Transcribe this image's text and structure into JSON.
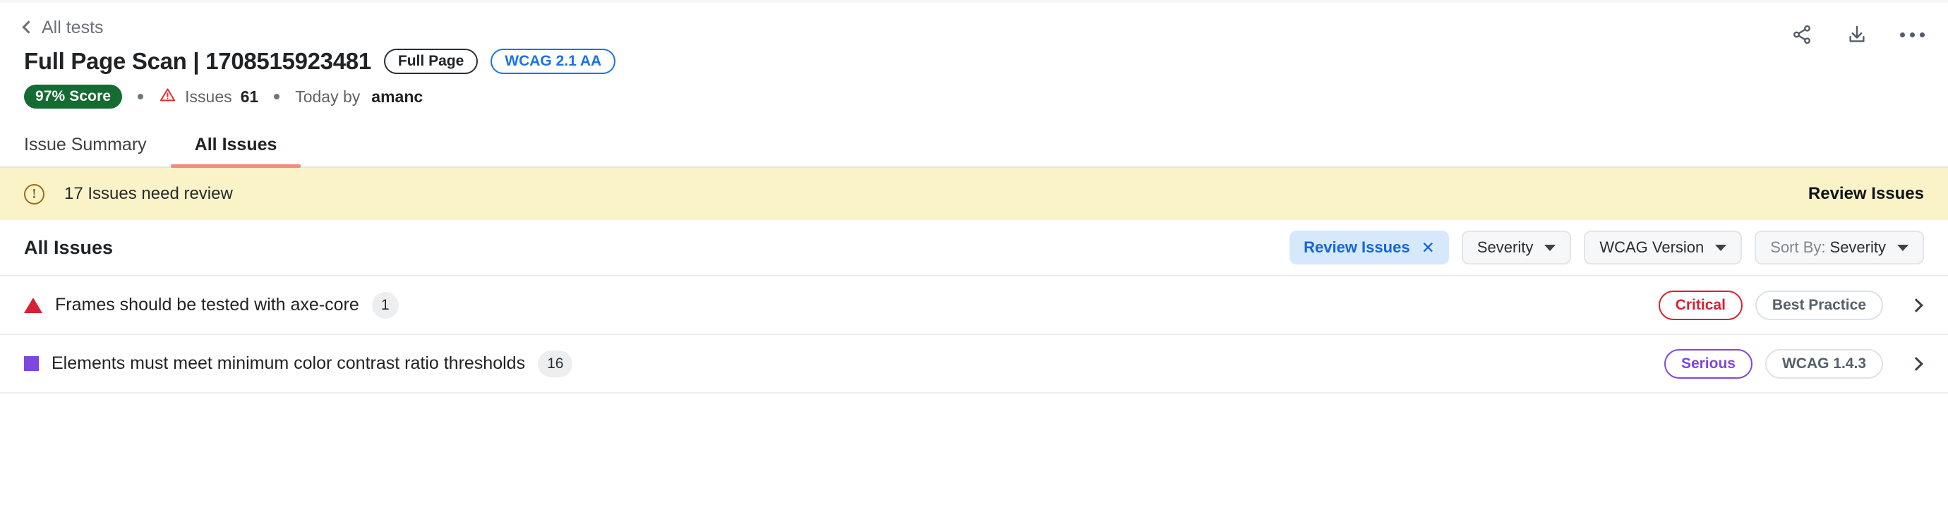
{
  "header": {
    "back_label": "All tests",
    "back_icon": "chevron-left-icon",
    "title": "Full Page Scan | 1708515923481",
    "tags": [
      {
        "label": "Full Page",
        "style": "outline-dark"
      },
      {
        "label": "WCAG 2.1 AA",
        "style": "outline-blue"
      }
    ],
    "actions": [
      {
        "name": "share-icon",
        "tooltip": "Share"
      },
      {
        "name": "download-icon",
        "tooltip": "Download"
      },
      {
        "name": "more-options-icon",
        "tooltip": "More"
      }
    ],
    "meta": {
      "score_badge": "97% Score",
      "score_color": "#156b31",
      "issues_label": "Issues",
      "issues_count": "61",
      "issues_icon": "warning-triangle-icon",
      "author_prefix": "Today by",
      "author": "amanc"
    }
  },
  "tabs": [
    {
      "label": "Issue Summary",
      "active": false
    },
    {
      "label": "All Issues",
      "active": true
    }
  ],
  "tab_accent_color": "#f58a7a",
  "banner": {
    "icon": "exclamation-circle-icon",
    "text": "17 Issues need review",
    "action_label": "Review Issues",
    "background": "#fbf3c8"
  },
  "list": {
    "title": "All Issues",
    "filters": [
      {
        "label": "Review Issues",
        "type": "active-chip",
        "removable": true,
        "remove_icon": "close-x-icon"
      },
      {
        "label": "Severity",
        "type": "dropdown",
        "icon": "chevron-down-icon"
      },
      {
        "label": "WCAG Version",
        "type": "dropdown",
        "icon": "chevron-down-icon"
      },
      {
        "label": "Sort By: Severity",
        "prefix": "Sort By: ",
        "value": "Severity",
        "type": "dropdown",
        "icon": "chevron-down-icon"
      }
    ],
    "rows": [
      {
        "severity_icon": "critical-triangle-icon",
        "severity_icon_color": "#d62232",
        "title": "Frames should be tested with axe-core",
        "count": "1",
        "severity_tag": "Critical",
        "severity_tag_style": "critical",
        "standard_tag": "Best Practice",
        "chevron_icon": "chevron-right-icon"
      },
      {
        "severity_icon": "serious-square-icon",
        "severity_icon_color": "#7e47e0",
        "title": "Elements must meet minimum color contrast ratio thresholds",
        "count": "16",
        "severity_tag": "Serious",
        "severity_tag_style": "serious",
        "standard_tag": "WCAG 1.4.3",
        "chevron_icon": "chevron-right-icon"
      }
    ]
  }
}
